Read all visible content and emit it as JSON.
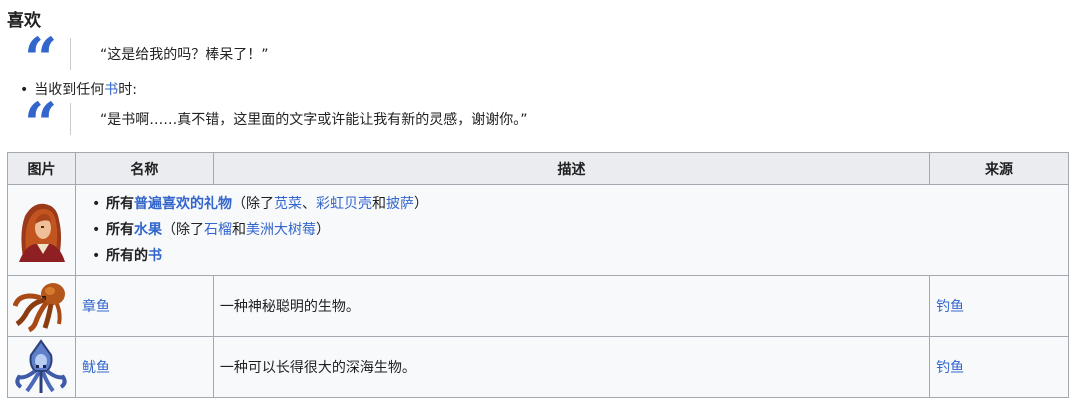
{
  "heading": "喜欢",
  "quote1": "“这是给我的吗？棒呆了！”",
  "bullet": {
    "prefix": "当收到任何",
    "link": "书",
    "suffix": "时:"
  },
  "quote2": "“是书啊……真不错，这里面的文字或许能让我有新的灵感，谢谢你。”",
  "table": {
    "headers": {
      "image": "图片",
      "name": "名称",
      "description": "描述",
      "source": "来源"
    },
    "prefs": {
      "p1": {
        "a": "所有",
        "b": "普遍喜欢的礼物",
        "c": "（除了",
        "d": "苋菜",
        "e": "、",
        "f": "彩虹贝壳",
        "g": "和",
        "h": "披萨",
        "i": "）"
      },
      "p2": {
        "a": "所有",
        "b": "水果",
        "c": "（除了",
        "d": "石榴",
        "e": "和",
        "f": "美洲大树莓",
        "g": "）"
      },
      "p3": {
        "a": "所有的",
        "b": "书"
      }
    },
    "rows": [
      {
        "name": "章鱼",
        "description": "一种神秘聪明的生物。",
        "source": "钓鱼"
      },
      {
        "name": "鱿鱼",
        "description": "一种可以长得很大的深海生物。",
        "source": "钓鱼"
      }
    ]
  },
  "colors": {
    "link": "#3366cc",
    "header_bg": "#eaecf0",
    "cell_bg": "#f8f9fa",
    "border": "#a2a9b1"
  },
  "icons": {
    "quote": "quote-mark-icon",
    "portrait": "elliott-portrait-icon",
    "octopus": "octopus-icon",
    "squid": "squid-icon"
  }
}
